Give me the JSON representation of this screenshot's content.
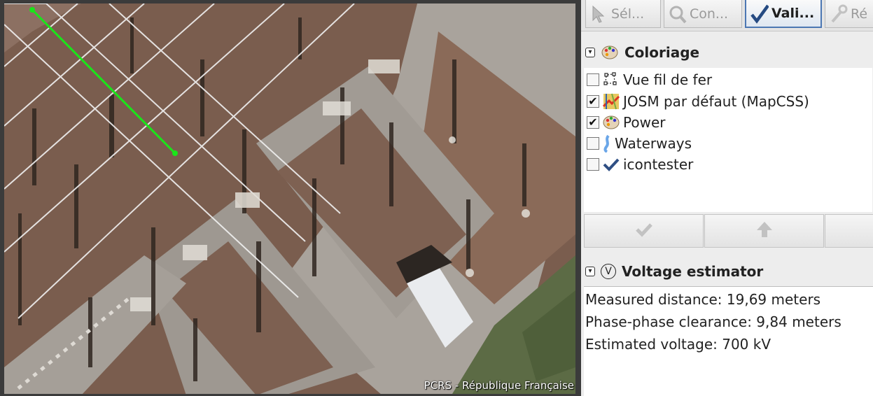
{
  "map": {
    "attribution": "PCRS - République Française"
  },
  "toolbar": {
    "tabs": [
      {
        "label": "Sél...",
        "icon": "select-icon",
        "active": false
      },
      {
        "label": "Con...",
        "icon": "zoom-icon",
        "active": false
      },
      {
        "label": "Vali...",
        "icon": "validator-check-icon",
        "active": true
      },
      {
        "label": "Ré",
        "icon": "wrench-icon",
        "active": false
      }
    ]
  },
  "coloriage": {
    "title": "Coloriage",
    "styles": [
      {
        "label": "Vue fil de fer",
        "checked": false,
        "icon": "wireframe-icon"
      },
      {
        "label": "JOSM par défaut (MapCSS)",
        "checked": true,
        "icon": "josm-style-icon"
      },
      {
        "label": "Power",
        "checked": true,
        "icon": "palette-icon"
      },
      {
        "label": "Waterways",
        "checked": false,
        "icon": "waterways-icon"
      },
      {
        "label": "icontester",
        "checked": false,
        "icon": "checkmark-icon"
      }
    ]
  },
  "voltage_estimator": {
    "title": "Voltage estimator",
    "icon_letter": "V",
    "lines": [
      "Measured distance: 19,69 meters",
      "Phase-phase clearance: 9,84 meters",
      "Estimated voltage: 700 kV"
    ]
  },
  "colors": {
    "measure_line": "#19e619",
    "active_tab_border": "#4c77b3",
    "ground": "#7b5e4f"
  }
}
